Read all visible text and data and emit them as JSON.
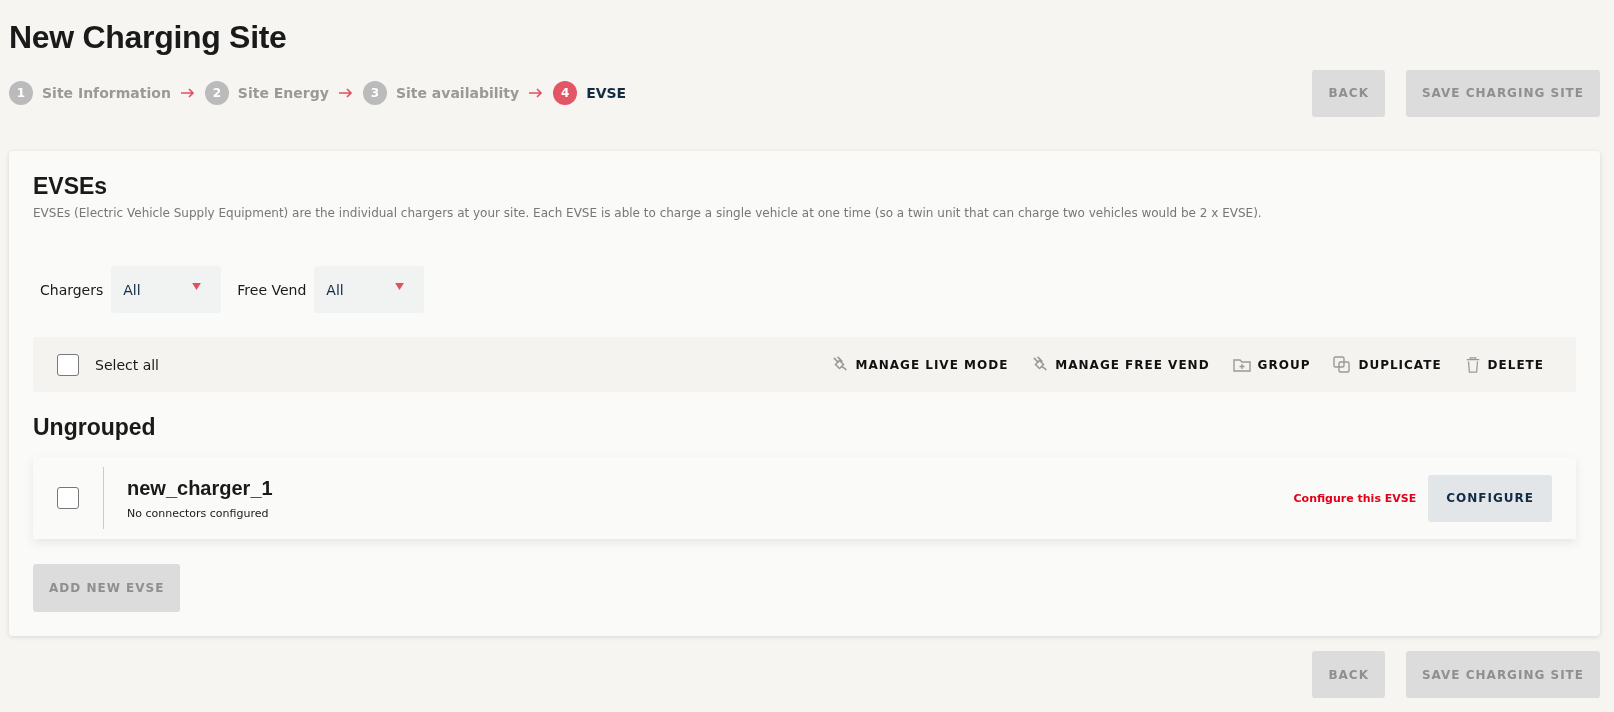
{
  "page": {
    "title": "New Charging Site"
  },
  "steps": [
    {
      "number": "1",
      "label": "Site Information",
      "selected": false
    },
    {
      "number": "2",
      "label": "Site Energy",
      "selected": false
    },
    {
      "number": "3",
      "label": "Site availability",
      "selected": false
    },
    {
      "number": "4",
      "label": "EVSE",
      "selected": true
    }
  ],
  "top_actions": [
    {
      "label": "BACK",
      "disabled": true
    },
    {
      "label": "SAVE CHARGING SITE",
      "disabled": true
    }
  ],
  "section": {
    "title": "EVSEs",
    "description": "EVSEs (Electric Vehicle Supply Equipment) are the individual chargers at your site. Each EVSE is able to charge a single vehicle at one time (so a twin unit that can charge two vehicles would be 2 x EVSE)."
  },
  "filters": [
    {
      "label": "Chargers",
      "value": "All"
    },
    {
      "label": "Free Vend",
      "value": "All"
    }
  ],
  "toolbar": {
    "select_all": {
      "label": "Select all",
      "checked": false
    },
    "actions": [
      {
        "kind": "plug",
        "label": "MANAGE LIVE MODE"
      },
      {
        "kind": "plug",
        "label": "MANAGE FREE VEND"
      },
      {
        "kind": "folder",
        "label": "GROUP"
      },
      {
        "kind": "copy",
        "label": "DUPLICATE"
      },
      {
        "kind": "trash",
        "label": "DELETE"
      }
    ]
  },
  "groups": [
    {
      "title": "Ungrouped",
      "evses": [
        {
          "name": "new_charger_1",
          "detail": "No connectors configured",
          "checked": false,
          "warning": "Configure this EVSE",
          "action": "CONFIGURE"
        }
      ]
    }
  ],
  "add_button": {
    "label": "ADD NEW EVSE",
    "disabled": true
  },
  "bottom_actions": [
    {
      "label": "BACK",
      "disabled": true
    },
    {
      "label": "SAVE CHARGING SITE",
      "disabled": true
    }
  ]
}
